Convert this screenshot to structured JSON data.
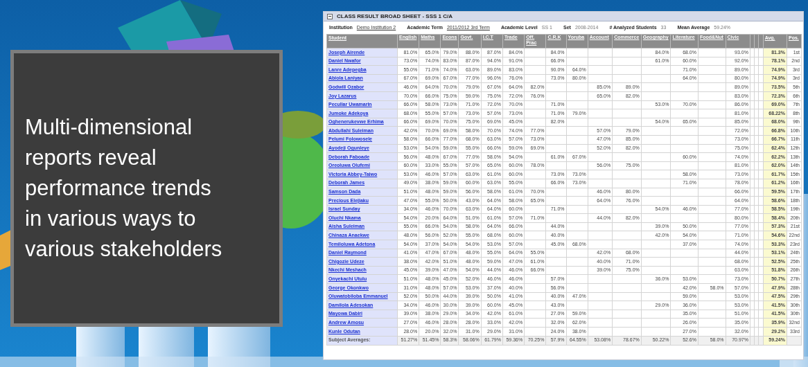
{
  "tagline": "Multi-dimensional reports reveal performance trends in various ways to various stakeholders",
  "sheet": {
    "title": "CLASS RESULT BROAD SHEET - SSS 1 C/A",
    "expanded": true,
    "info": [
      {
        "label": "Institution",
        "value": "Demo Institution 2",
        "kind": "link"
      },
      {
        "label": "Academic Term",
        "value": "2011/2012 3rd Term",
        "kind": "link"
      },
      {
        "label": "Academic Level",
        "value": "SS 1",
        "kind": "text"
      },
      {
        "label": "Set",
        "value": "2008-2014",
        "kind": "text"
      },
      {
        "label": "# Analyzed Students",
        "value": "33",
        "kind": "text"
      },
      {
        "label": "Mean Average",
        "value": "59.24%",
        "kind": "text"
      }
    ],
    "student_column": "Student",
    "avg_column": "Avg.",
    "pos_column": "Pos.",
    "subjects": [
      "English",
      "Maths",
      "Econs",
      "Govt.",
      "I.C.T",
      "Trade",
      "Off. Prac",
      "C.R.K",
      "Yoruba",
      "Account",
      "Commerce",
      "Geography",
      "Literature",
      "Food&Nut",
      "Civic"
    ],
    "rows": [
      {
        "student": "Joseph Airende",
        "scores": {
          "english": "81.0%",
          "maths": "65.0%",
          "econs": "79.0%",
          "govt": "88.0%",
          "ict": "87.0%",
          "trade": "84.0%",
          "crk": "84.0%",
          "geography": "84.0%",
          "literature": "68.0%",
          "civic": "93.0%"
        },
        "avg": "81.3%",
        "pos": "1st"
      },
      {
        "student": "Daniel Nwafor",
        "scores": {
          "english": "73.0%",
          "maths": "74.0%",
          "econs": "83.0%",
          "govt": "87.0%",
          "ict": "94.0%",
          "trade": "91.0%",
          "crk": "66.0%",
          "geography": "61.0%",
          "literature": "60.0%",
          "civic": "92.0%"
        },
        "avg": "78.1%",
        "pos": "2nd"
      },
      {
        "student": "Lanre Adepegba",
        "scores": {
          "english": "55.0%",
          "maths": "71.0%",
          "econs": "74.0%",
          "govt": "63.0%",
          "ict": "89.0%",
          "trade": "83.0%",
          "crk": "90.0%",
          "yoruba": "64.0%",
          "literature": "71.0%",
          "civic": "89.0%"
        },
        "avg": "74.9%",
        "pos": "3rd"
      },
      {
        "student": "Abiola Laniyan",
        "scores": {
          "english": "67.0%",
          "maths": "69.0%",
          "econs": "67.0%",
          "govt": "77.0%",
          "ict": "96.0%",
          "trade": "76.0%",
          "crk": "73.0%",
          "yoruba": "80.0%",
          "literature": "64.0%",
          "civic": "80.0%"
        },
        "avg": "74.9%",
        "pos": "3rd"
      },
      {
        "student": "Godwill Ozabor",
        "scores": {
          "english": "46.0%",
          "maths": "64.0%",
          "econs": "70.0%",
          "govt": "79.0%",
          "ict": "67.0%",
          "trade": "64.0%",
          "off_prac": "82.0%",
          "account": "85.0%",
          "commerce": "89.0%",
          "civic": "89.0%"
        },
        "avg": "73.5%",
        "pos": "5th"
      },
      {
        "student": "Joy Lazarus",
        "scores": {
          "english": "70.0%",
          "maths": "66.0%",
          "econs": "75.0%",
          "govt": "59.0%",
          "ict": "75.0%",
          "trade": "72.0%",
          "off_prac": "76.0%",
          "account": "65.0%",
          "commerce": "82.0%",
          "civic": "83.0%"
        },
        "avg": "72.3%",
        "pos": "6th"
      },
      {
        "student": "Peculiar Uwamarin",
        "scores": {
          "english": "66.0%",
          "maths": "58.0%",
          "econs": "73.0%",
          "govt": "71.0%",
          "ict": "72.0%",
          "trade": "70.0%",
          "crk": "71.0%",
          "geography": "53.0%",
          "literature": "70.0%",
          "civic": "86.0%"
        },
        "avg": "69.0%",
        "pos": "7th"
      },
      {
        "student": "Jumoke Adekoya",
        "scores": {
          "english": "68.0%",
          "maths": "55.0%",
          "econs": "57.0%",
          "govt": "73.0%",
          "ict": "57.0%",
          "trade": "73.0%",
          "crk": "71.0%",
          "yoruba": "79.0%",
          "civic": "81.0%"
        },
        "avg": "68.22%",
        "pos": "8th"
      },
      {
        "student": "Oghenerukevwe Erhima",
        "scores": {
          "english": "66.0%",
          "maths": "69.0%",
          "econs": "70.0%",
          "govt": "75.0%",
          "ict": "69.0%",
          "trade": "45.0%",
          "crk": "82.0%",
          "geography": "54.0%",
          "literature": "65.0%",
          "civic": "85.0%"
        },
        "avg": "68.0%",
        "pos": "9th"
      },
      {
        "student": "Abdullahi Suleiman",
        "scores": {
          "english": "42.0%",
          "maths": "70.0%",
          "econs": "69.0%",
          "govt": "58.0%",
          "ict": "70.0%",
          "trade": "74.0%",
          "off_prac": "77.0%",
          "account": "57.0%",
          "commerce": "79.0%",
          "civic": "72.0%"
        },
        "avg": "66.8%",
        "pos": "10th"
      },
      {
        "student": "Pelumi Folowosele",
        "scores": {
          "english": "58.0%",
          "maths": "66.0%",
          "econs": "77.0%",
          "govt": "68.0%",
          "ict": "63.0%",
          "trade": "57.0%",
          "off_prac": "73.0%",
          "account": "47.0%",
          "commerce": "85.0%",
          "civic": "73.0%"
        },
        "avg": "66.7%",
        "pos": "11th"
      },
      {
        "student": "Ayodeji Ogunleye",
        "scores": {
          "english": "53.0%",
          "maths": "54.0%",
          "econs": "59.0%",
          "govt": "55.0%",
          "ict": "66.0%",
          "trade": "59.0%",
          "off_prac": "69.0%",
          "account": "52.0%",
          "commerce": "82.0%",
          "civic": "75.0%"
        },
        "avg": "62.4%",
        "pos": "12th"
      },
      {
        "student": "Deborah Faboade",
        "scores": {
          "english": "56.0%",
          "maths": "48.0%",
          "econs": "67.0%",
          "govt": "77.0%",
          "ict": "58.0%",
          "trade": "54.0%",
          "crk": "61.0%",
          "yoruba": "67.0%",
          "literature": "60.0%",
          "civic": "74.0%"
        },
        "avg": "62.2%",
        "pos": "13th"
      },
      {
        "student": "Oreoluwa Olufemi",
        "scores": {
          "english": "60.0%",
          "maths": "33.0%",
          "econs": "55.0%",
          "govt": "57.0%",
          "ict": "65.0%",
          "trade": "60.0%",
          "off_prac": "78.0%",
          "account": "56.0%",
          "commerce": "75.0%",
          "civic": "81.0%"
        },
        "avg": "62.0%",
        "pos": "14th"
      },
      {
        "student": "Victoria Abbey-Taiwo",
        "scores": {
          "english": "53.0%",
          "maths": "46.0%",
          "econs": "57.0%",
          "govt": "63.0%",
          "ict": "61.0%",
          "trade": "60.0%",
          "crk": "73.0%",
          "yoruba": "73.0%",
          "literature": "58.0%",
          "civic": "73.0%"
        },
        "avg": "61.7%",
        "pos": "15th"
      },
      {
        "student": "Deborah James",
        "scores": {
          "english": "49.0%",
          "maths": "38.0%",
          "econs": "59.0%",
          "govt": "60.0%",
          "ict": "63.0%",
          "trade": "55.0%",
          "crk": "66.0%",
          "yoruba": "73.0%",
          "literature": "71.0%",
          "civic": "78.0%"
        },
        "avg": "61.2%",
        "pos": "16th"
      },
      {
        "student": "Samson Dada",
        "scores": {
          "english": "51.0%",
          "maths": "48.0%",
          "econs": "59.0%",
          "govt": "56.0%",
          "ict": "58.0%",
          "trade": "61.0%",
          "off_prac": "70.0%",
          "account": "46.0%",
          "commerce": "80.0%",
          "civic": "66.0%"
        },
        "avg": "59.5%",
        "pos": "17th"
      },
      {
        "student": "Precious Elejiaku",
        "scores": {
          "english": "47.0%",
          "maths": "55.0%",
          "econs": "50.0%",
          "govt": "43.0%",
          "ict": "64.0%",
          "trade": "58.0%",
          "off_prac": "65.0%",
          "account": "64.0%",
          "commerce": "76.0%",
          "civic": "64.0%"
        },
        "avg": "58.6%",
        "pos": "18th"
      },
      {
        "student": "Israel Sunday",
        "scores": {
          "english": "34.0%",
          "maths": "46.0%",
          "econs": "70.0%",
          "govt": "63.0%",
          "ict": "64.0%",
          "trade": "60.0%",
          "crk": "71.0%",
          "geography": "54.0%",
          "literature": "46.0%",
          "civic": "77.0%"
        },
        "avg": "58.5%",
        "pos": "19th"
      },
      {
        "student": "Oluchi Nkama",
        "scores": {
          "english": "54.0%",
          "maths": "20.0%",
          "econs": "64.0%",
          "govt": "51.0%",
          "ict": "61.0%",
          "trade": "57.0%",
          "off_prac": "71.0%",
          "account": "44.0%",
          "commerce": "82.0%",
          "civic": "80.0%"
        },
        "avg": "58.4%",
        "pos": "20th"
      },
      {
        "student": "Aisha Suleiman",
        "scores": {
          "english": "55.0%",
          "maths": "66.0%",
          "econs": "54.0%",
          "govt": "58.0%",
          "ict": "64.0%",
          "trade": "66.0%",
          "crk": "44.0%",
          "geography": "39.0%",
          "literature": "50.0%",
          "civic": "77.0%"
        },
        "avg": "57.3%",
        "pos": "21st"
      },
      {
        "student": "Chinaza Anaekwe",
        "scores": {
          "english": "48.0%",
          "maths": "56.0%",
          "econs": "52.0%",
          "govt": "55.0%",
          "ict": "68.0%",
          "trade": "60.0%",
          "crk": "40.0%",
          "geography": "42.0%",
          "literature": "54.0%",
          "civic": "71.0%"
        },
        "avg": "54.6%",
        "pos": "22nd"
      },
      {
        "student": "Temiloluwa Adetona",
        "scores": {
          "english": "54.0%",
          "maths": "37.0%",
          "econs": "54.0%",
          "govt": "54.0%",
          "ict": "53.0%",
          "trade": "57.0%",
          "crk": "45.0%",
          "yoruba": "68.0%",
          "literature": "37.0%",
          "civic": "74.0%"
        },
        "avg": "53.3%",
        "pos": "23rd"
      },
      {
        "student": "Daniel Raymond",
        "scores": {
          "english": "41.0%",
          "maths": "47.0%",
          "econs": "67.0%",
          "govt": "48.0%",
          "ict": "55.0%",
          "trade": "64.0%",
          "off_prac": "55.0%",
          "account": "42.0%",
          "commerce": "68.0%",
          "civic": "44.0%"
        },
        "avg": "53.1%",
        "pos": "24th"
      },
      {
        "student": "Chigozie Udeze",
        "scores": {
          "english": "38.0%",
          "maths": "42.0%",
          "econs": "51.0%",
          "govt": "48.0%",
          "ict": "59.0%",
          "trade": "47.0%",
          "off_prac": "61.0%",
          "account": "40.0%",
          "commerce": "71.0%",
          "civic": "68.0%"
        },
        "avg": "52.5%",
        "pos": "25th"
      },
      {
        "student": "Nkechi Meshach",
        "scores": {
          "english": "45.0%",
          "maths": "39.0%",
          "econs": "47.0%",
          "govt": "54.0%",
          "ict": "44.0%",
          "trade": "46.0%",
          "off_prac": "66.0%",
          "account": "39.0%",
          "commerce": "75.0%",
          "civic": "63.0%"
        },
        "avg": "51.8%",
        "pos": "26th"
      },
      {
        "student": "Onyekachi Utulu",
        "scores": {
          "english": "51.0%",
          "maths": "48.0%",
          "econs": "45.0%",
          "govt": "52.0%",
          "ict": "46.0%",
          "trade": "46.0%",
          "crk": "57.0%",
          "geography": "36.0%",
          "literature": "53.0%",
          "civic": "73.0%"
        },
        "avg": "50.7%",
        "pos": "27th"
      },
      {
        "student": "George Okonkwo",
        "scores": {
          "english": "31.0%",
          "maths": "48.0%",
          "econs": "57.0%",
          "govt": "53.0%",
          "ict": "37.0%",
          "trade": "40.0%",
          "crk": "56.0%",
          "literature": "42.0%",
          "food_nut": "58.0%",
          "civic": "57.0%"
        },
        "avg": "47.9%",
        "pos": "28th"
      },
      {
        "student": "Oluwatobiloba Emmanuel",
        "scores": {
          "english": "52.0%",
          "maths": "50.0%",
          "econs": "44.0%",
          "govt": "39.0%",
          "ict": "50.0%",
          "trade": "41.0%",
          "crk": "40.0%",
          "yoruba": "47.0%",
          "literature": "59.0%",
          "civic": "53.0%"
        },
        "avg": "47.5%",
        "pos": "29th"
      },
      {
        "student": "Damilola Adesokan",
        "scores": {
          "english": "34.0%",
          "maths": "46.0%",
          "econs": "30.0%",
          "govt": "39.0%",
          "ict": "60.0%",
          "trade": "45.0%",
          "crk": "43.0%",
          "geography": "29.0%",
          "literature": "36.0%",
          "civic": "53.0%"
        },
        "avg": "41.5%",
        "pos": "30th"
      },
      {
        "student": "Mayowa Dabiri",
        "scores": {
          "english": "39.0%",
          "maths": "38.0%",
          "econs": "29.0%",
          "govt": "34.0%",
          "ict": "42.0%",
          "trade": "61.0%",
          "crk": "27.0%",
          "yoruba": "59.0%",
          "literature": "35.0%",
          "civic": "51.0%"
        },
        "avg": "41.5%",
        "pos": "30th"
      },
      {
        "student": "Andrew Amosu",
        "scores": {
          "english": "27.0%",
          "maths": "46.0%",
          "econs": "28.0%",
          "govt": "28.0%",
          "ict": "33.0%",
          "trade": "42.0%",
          "crk": "32.0%",
          "yoruba": "62.0%",
          "literature": "26.0%",
          "civic": "35.0%"
        },
        "avg": "35.9%",
        "pos": "32nd"
      },
      {
        "student": "Kunle Odutan",
        "scores": {
          "english": "28.0%",
          "maths": "20.0%",
          "econs": "32.0%",
          "govt": "31.0%",
          "ict": "29.0%",
          "trade": "31.0%",
          "crk": "24.0%",
          "yoruba": "38.0%",
          "literature": "27.0%",
          "civic": "32.0%"
        },
        "avg": "29.2%",
        "pos": "33rd"
      }
    ],
    "averages": {
      "label": "Subject Averages:",
      "scores": {
        "english": "51.27%",
        "maths": "51.45%",
        "econs": "58.3%",
        "govt": "58.06%",
        "ict": "61.79%",
        "trade": "59.36%",
        "off_prac": "70.25%",
        "crk": "57.9%",
        "yoruba": "64.55%",
        "account": "53.08%",
        "commerce": "78.67%",
        "geography": "50.22%",
        "literature": "52.6%",
        "food_nut": "58.0%",
        "civic": "70.97%"
      },
      "avg": "59.24%"
    }
  }
}
